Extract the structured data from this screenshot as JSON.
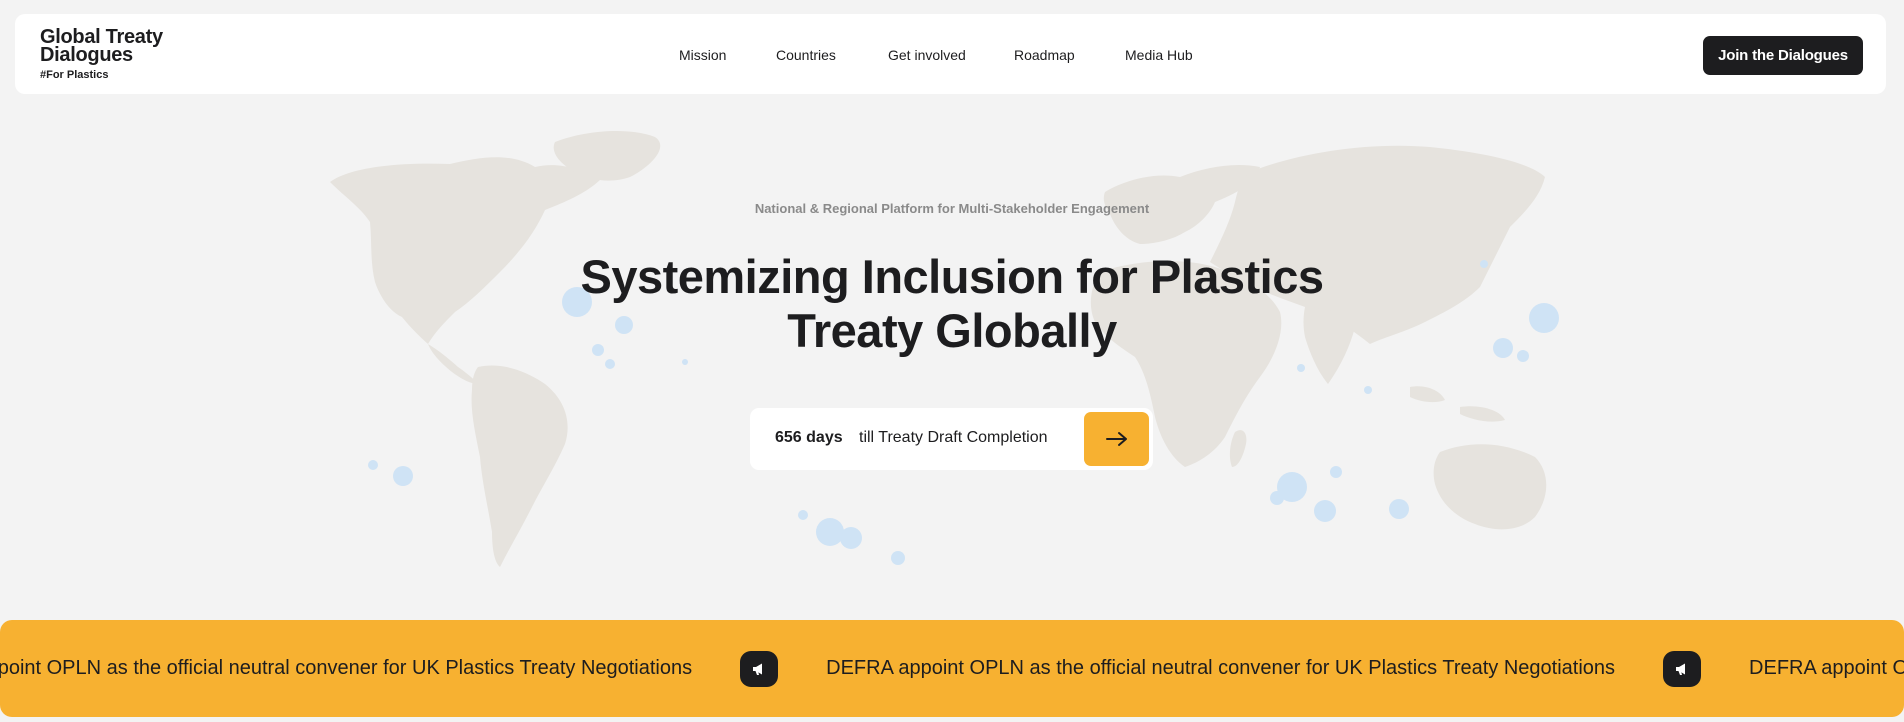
{
  "brand": {
    "line1": "Global Treaty",
    "line2": "Dialogues",
    "tag": "#For Plastics"
  },
  "nav": {
    "items": [
      {
        "label": "Mission"
      },
      {
        "label": "Countries"
      },
      {
        "label": "Get involved"
      },
      {
        "label": "Roadmap"
      },
      {
        "label": "Media Hub"
      }
    ],
    "cta_label": "Join the Dialogues"
  },
  "hero": {
    "subtitle": "National & Regional Platform for Multi-Stakeholder Engagement",
    "headline_line1": "Systemizing Inclusion for Plastics",
    "headline_line2": "Treaty Globally",
    "countdown_days": "656 days",
    "countdown_label": "till Treaty Draft Completion",
    "arrow_icon": "arrow-right-icon"
  },
  "ticker": {
    "fragment_start": "FRA appoint OPLN as the official neutral convener for UK Plastics Treaty Negotiations",
    "message": "DEFRA appoint OPLN as the official neutral convener for UK Plastics Treaty Negotiations",
    "fragment_end": "DEFRA appoint O",
    "icon": "megaphone-icon"
  },
  "colors": {
    "accent": "#f7b131",
    "dark": "#1d1d1f",
    "background": "#f3f3f3",
    "map_land": "#e6e3de",
    "map_bubbles": "#cfe3f5"
  }
}
